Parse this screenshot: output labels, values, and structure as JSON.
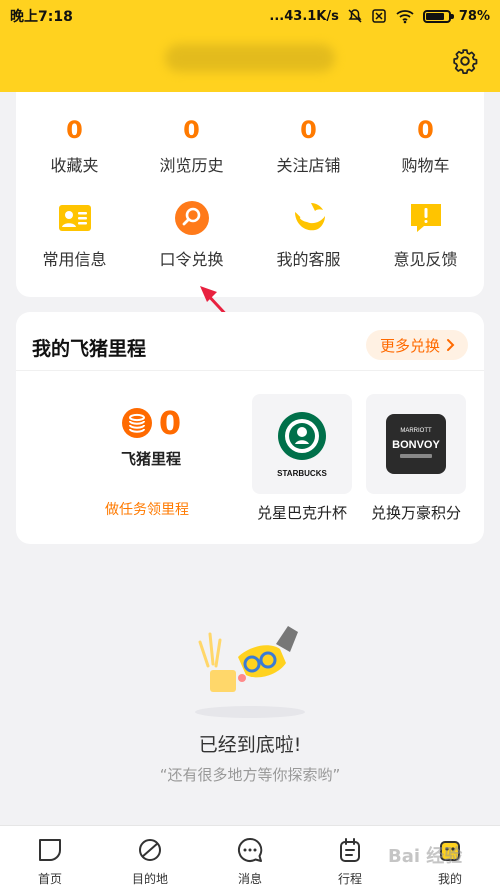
{
  "status_bar": {
    "time": "晚上7:18",
    "network_speed": "...43.1K/s",
    "battery": "78%"
  },
  "stats": [
    {
      "value": "0",
      "label": "收藏夹"
    },
    {
      "value": "0",
      "label": "浏览历史"
    },
    {
      "value": "0",
      "label": "关注店铺"
    },
    {
      "value": "0",
      "label": "购物车"
    }
  ],
  "actions": [
    {
      "label": "常用信息",
      "icon": "id-card-icon"
    },
    {
      "label": "口令兑换",
      "icon": "search-icon"
    },
    {
      "label": "我的客服",
      "icon": "service-icon"
    },
    {
      "label": "意见反馈",
      "icon": "feedback-icon"
    }
  ],
  "miles_card": {
    "title": "我的飞猪里程",
    "more_label": "更多兑换",
    "miles_value": "0",
    "miles_label": "飞猪里程",
    "task_link": "做任务领里程",
    "products": [
      {
        "label": "兑星巴克升杯",
        "logo_text": "STARBUCKS"
      },
      {
        "label": "兑换万豪积分",
        "logo_text": "BONVOY"
      }
    ]
  },
  "empty_state": {
    "title": "已经到底啦!",
    "subtitle": "“还有很多地方等你探索哟”"
  },
  "bottom_nav": [
    {
      "label": "首页",
      "icon": "home-icon"
    },
    {
      "label": "目的地",
      "icon": "destination-icon"
    },
    {
      "label": "消息",
      "icon": "message-icon"
    },
    {
      "label": "行程",
      "icon": "trip-icon"
    },
    {
      "label": "我的",
      "icon": "mine-icon"
    }
  ],
  "colors": {
    "brand_yellow": "#ffd21f",
    "accent_orange": "#ff7a00"
  }
}
